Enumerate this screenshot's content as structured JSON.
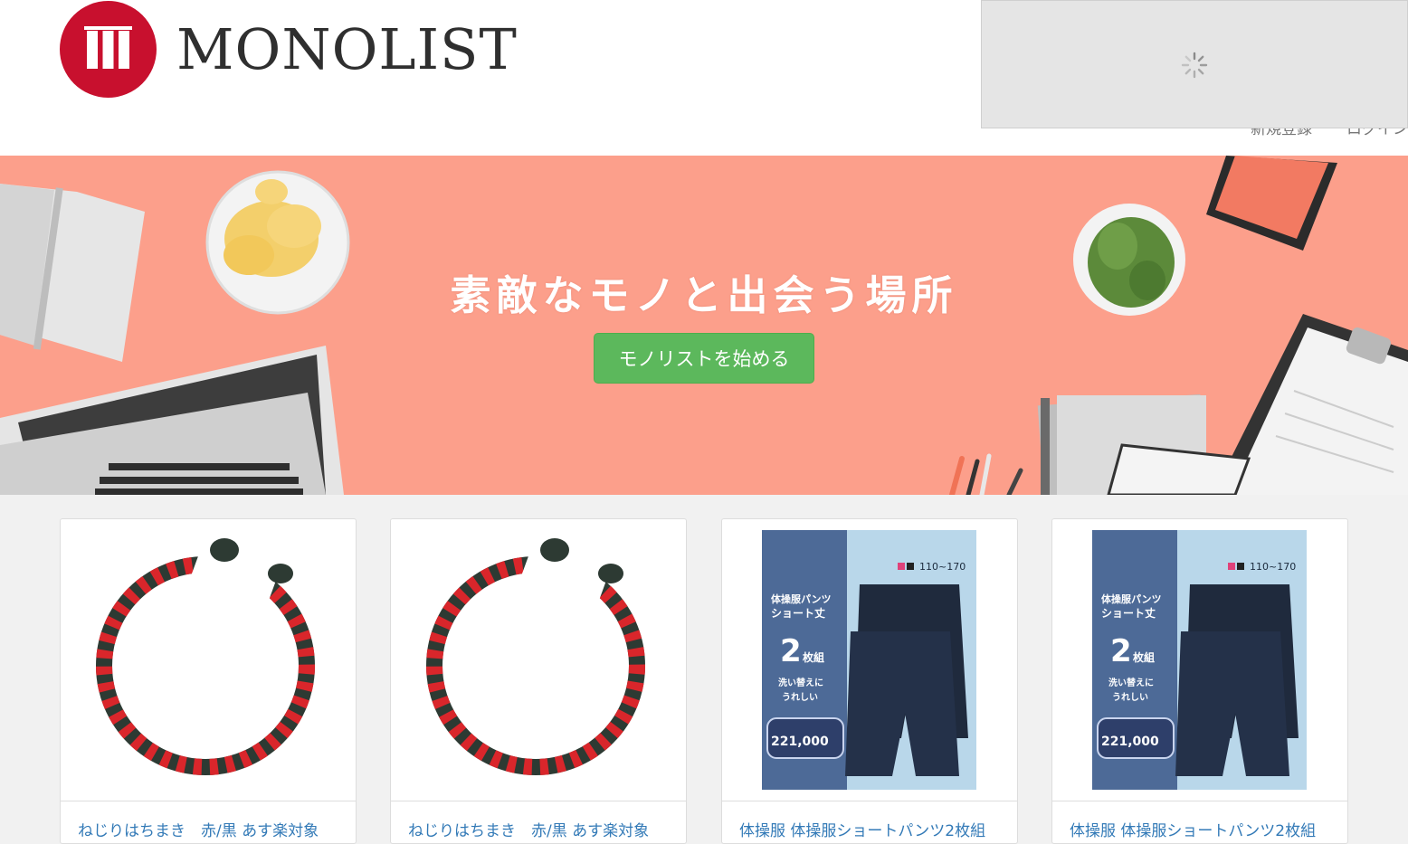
{
  "brand": {
    "name": "MONOLIST",
    "logo_color": "#c8102e"
  },
  "header": {
    "nav": [
      "新規登録",
      "ログイン"
    ]
  },
  "hero": {
    "title": "素敵なモノと出会う場所",
    "button_label": "モノリストを始める",
    "background": "#fc9f8b"
  },
  "products": [
    {
      "title": "ねじりはちまき　赤/黒 あす楽対象",
      "image": "twisted-headband"
    },
    {
      "title": "ねじりはちまき　赤/黒 あす楽対象",
      "image": "twisted-headband"
    },
    {
      "title": "体操服 体操服ショートパンツ2枚組",
      "image": "gym-shorts"
    },
    {
      "title": "体操服 体操服ショートパンツ2枚組",
      "image": "gym-shorts"
    }
  ],
  "product_image_text": {
    "size_range": "110~170",
    "line1": "体操服パンツ",
    "line2": "ショート丈",
    "count_num": "2",
    "count_suffix": "枚組",
    "line3": "洗い替えに",
    "line4": "うれしい",
    "badge_num": "221,000"
  }
}
